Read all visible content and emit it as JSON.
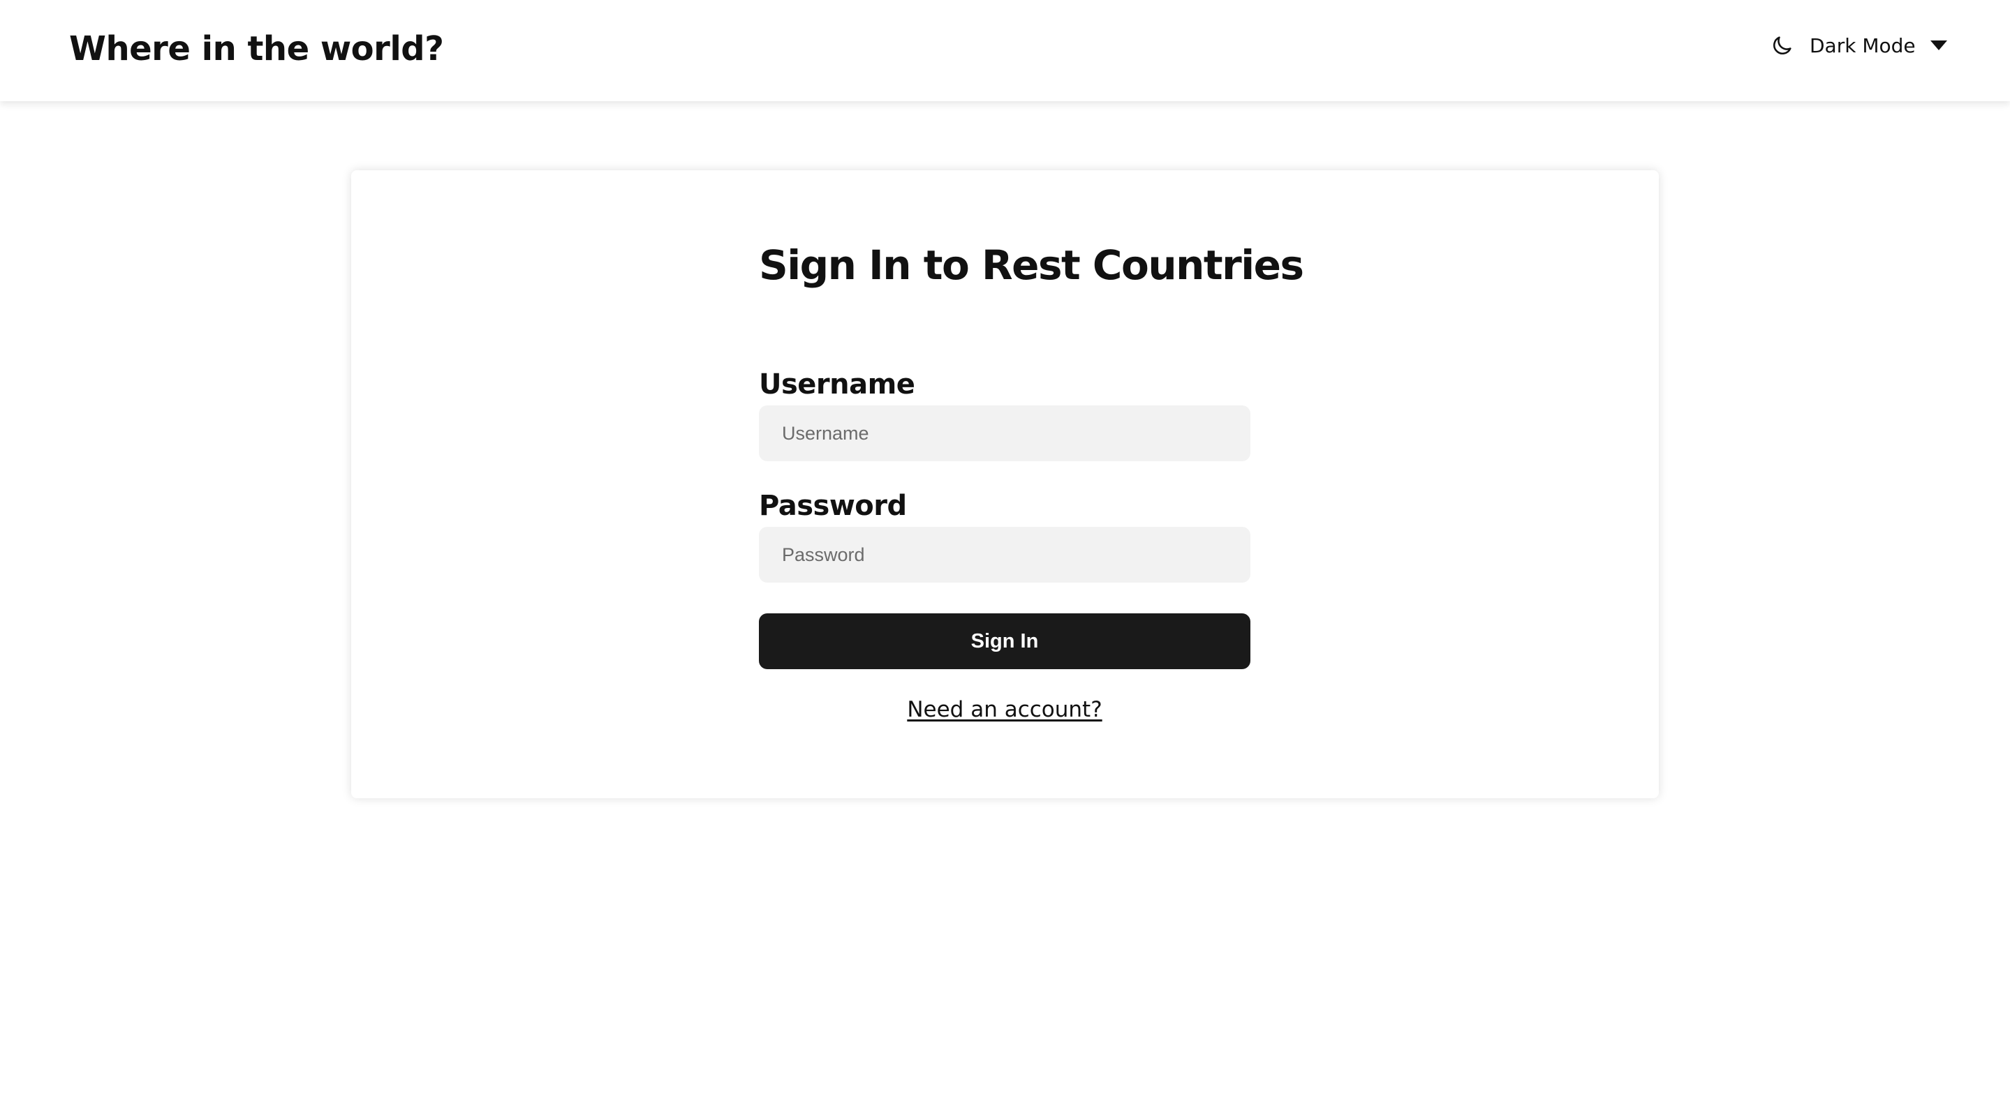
{
  "header": {
    "title": "Where in the world?",
    "theme_toggle": {
      "label": "Dark Mode",
      "icon": "moon-icon",
      "dropdown_icon": "caret-down-icon"
    }
  },
  "signin_form": {
    "title": "Sign In to Rest Countries",
    "username": {
      "label": "Username",
      "placeholder": "Username",
      "value": ""
    },
    "password": {
      "label": "Password",
      "placeholder": "Password",
      "value": ""
    },
    "submit_label": "Sign In",
    "signup_link": "Need an account?"
  },
  "colors": {
    "background": "#ffffff",
    "text": "#111111",
    "input_background": "#f2f2f2",
    "button_background": "#1a1a1a",
    "button_text": "#ffffff"
  }
}
